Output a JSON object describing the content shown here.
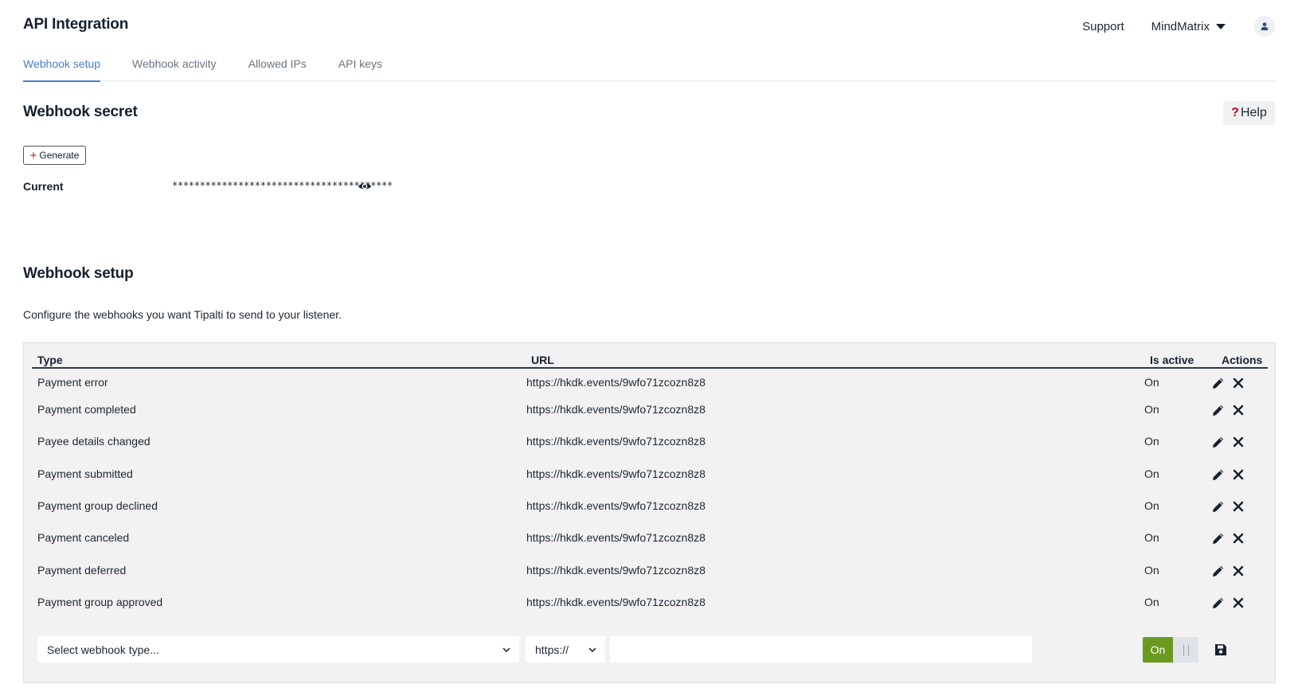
{
  "header": {
    "title": "API Integration",
    "support_label": "Support",
    "org_name": "MindMatrix"
  },
  "tabs": [
    {
      "label": "Webhook setup",
      "active": true
    },
    {
      "label": "Webhook activity",
      "active": false
    },
    {
      "label": "Allowed IPs",
      "active": false
    },
    {
      "label": "API keys",
      "active": false
    }
  ],
  "secret_section": {
    "title": "Webhook secret",
    "help_label": "Help",
    "generate_label": "Generate",
    "current_label": "Current",
    "secret_masked": "****************************************"
  },
  "setup_section": {
    "title": "Webhook setup",
    "description": "Configure the webhooks you want Tipalti to send to your listener."
  },
  "table": {
    "columns": [
      "Type",
      "URL",
      "Is active",
      "Actions"
    ],
    "rows": [
      {
        "type": "Payment error",
        "url": "https://hkdk.events/9wfo71zcozn8z8",
        "active": "On"
      },
      {
        "type": "Payment completed",
        "url": "https://hkdk.events/9wfo71zcozn8z8",
        "active": "On"
      },
      {
        "type": "Payee details changed",
        "url": "https://hkdk.events/9wfo71zcozn8z8",
        "active": "On"
      },
      {
        "type": "Payment submitted",
        "url": "https://hkdk.events/9wfo71zcozn8z8",
        "active": "On"
      },
      {
        "type": "Payment group declined",
        "url": "https://hkdk.events/9wfo71zcozn8z8",
        "active": "On"
      },
      {
        "type": "Payment canceled",
        "url": "https://hkdk.events/9wfo71zcozn8z8",
        "active": "On"
      },
      {
        "type": "Payment deferred",
        "url": "https://hkdk.events/9wfo71zcozn8z8",
        "active": "On"
      },
      {
        "type": "Payment group approved",
        "url": "https://hkdk.events/9wfo71zcozn8z8",
        "active": "On"
      }
    ]
  },
  "new_webhook": {
    "type_placeholder": "Select webhook type...",
    "protocol": "https://",
    "url_value": "",
    "toggle_label": "On"
  },
  "colors": {
    "accent": "#4a7ccf",
    "toggle_on": "#6a9a1f",
    "help_mark": "#d0021b",
    "text_dark": "#14212e"
  },
  "icons": [
    "user-icon",
    "caret-down-icon",
    "help-icon",
    "plus-icon",
    "eye-icon",
    "pencil-icon",
    "close-icon",
    "chevron-down-icon",
    "save-icon"
  ]
}
